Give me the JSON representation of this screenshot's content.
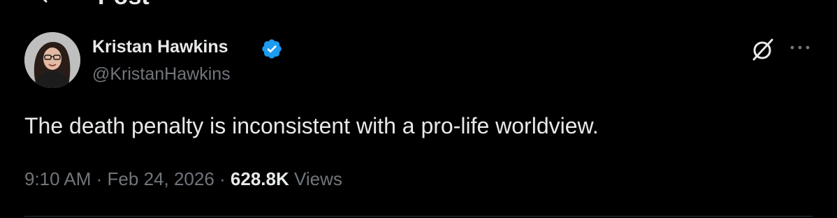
{
  "header": {
    "title": "Post"
  },
  "post": {
    "author_name": "Kristan Hawkins",
    "author_handle": "@KristanHawkins",
    "verified": true,
    "text": "The death penalty is inconsistent with a pro-life worldview.",
    "time": "9:10 AM",
    "date": "Feb 24, 2026",
    "separator": "·",
    "views_count": "628.8K",
    "views_label": "Views"
  },
  "colors": {
    "background": "#000000",
    "primary_text": "#e7e9ea",
    "secondary_text": "#71767b",
    "verified_badge": "#1d9bf0",
    "divider": "#2f3336"
  },
  "icons": {
    "back": "back-arrow-icon",
    "verified": "verified-badge-icon",
    "grok": "grok-icon",
    "more": "more-icon"
  }
}
